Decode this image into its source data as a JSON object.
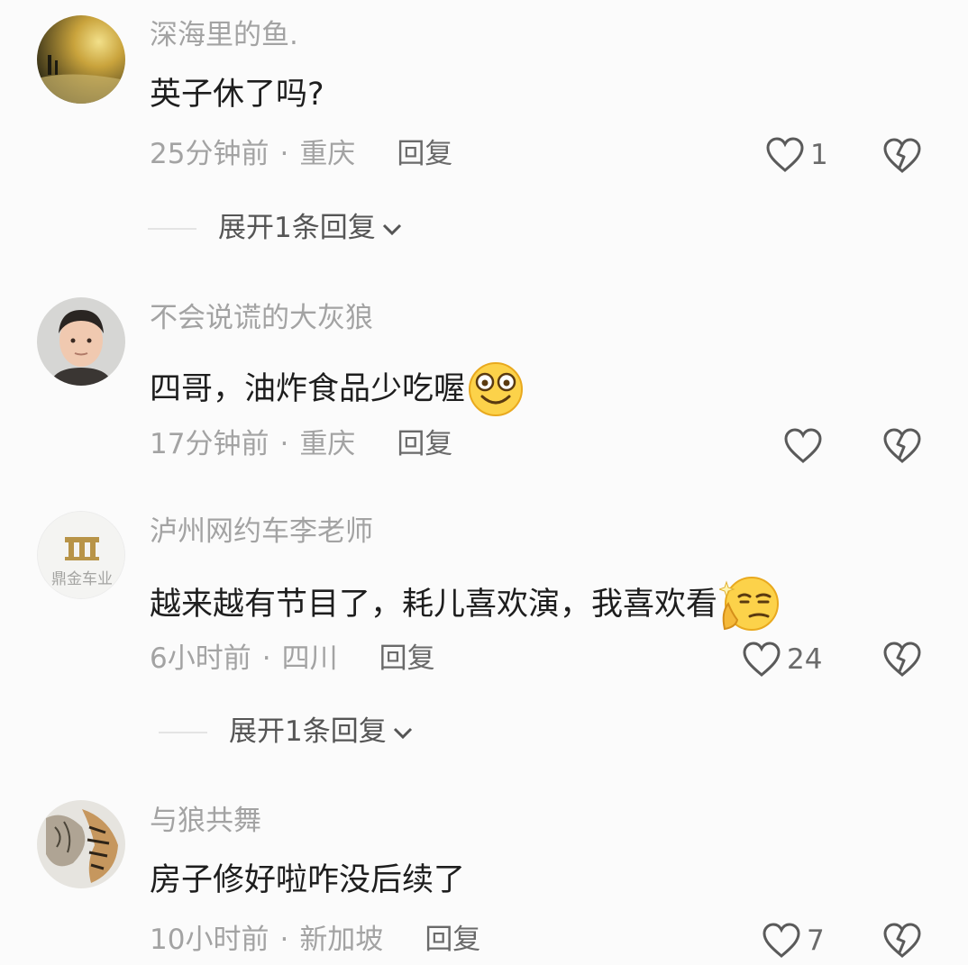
{
  "comments": [
    {
      "username": "深海里的鱼.",
      "text": "英子休了吗?",
      "time": "25分钟前",
      "location": "重庆",
      "reply_label": "回复",
      "like_count": "1",
      "expand_label": "展开1条回复",
      "avatar": "night-road-photo"
    },
    {
      "username": "不会说谎的大灰狼",
      "text": "四哥，油炸食品少吃喔",
      "emoji": "smile-emoji",
      "time": "17分钟前",
      "location": "重庆",
      "reply_label": "回复",
      "like_count": "",
      "avatar": "man-selfie-photo"
    },
    {
      "username": "泸州网约车李老师",
      "text": "越来越有节目了，耗儿喜欢演，我喜欢看",
      "emoji": "thinking-emoji",
      "time": "6小时前",
      "location": "四川",
      "reply_label": "回复",
      "like_count": "24",
      "expand_label": "展开1条回复",
      "avatar": "logo",
      "avatar_text": "鼎金车业"
    },
    {
      "username": "与狼共舞",
      "text": "房子修好啦咋没后续了",
      "time": "10小时前",
      "location": "新加坡",
      "reply_label": "回复",
      "like_count": "7",
      "avatar": "tiger-painting"
    }
  ],
  "separator": "·",
  "icons": {
    "like": "heart-outline-icon",
    "dislike": "broken-heart-icon",
    "expand": "chevron-down-icon"
  }
}
